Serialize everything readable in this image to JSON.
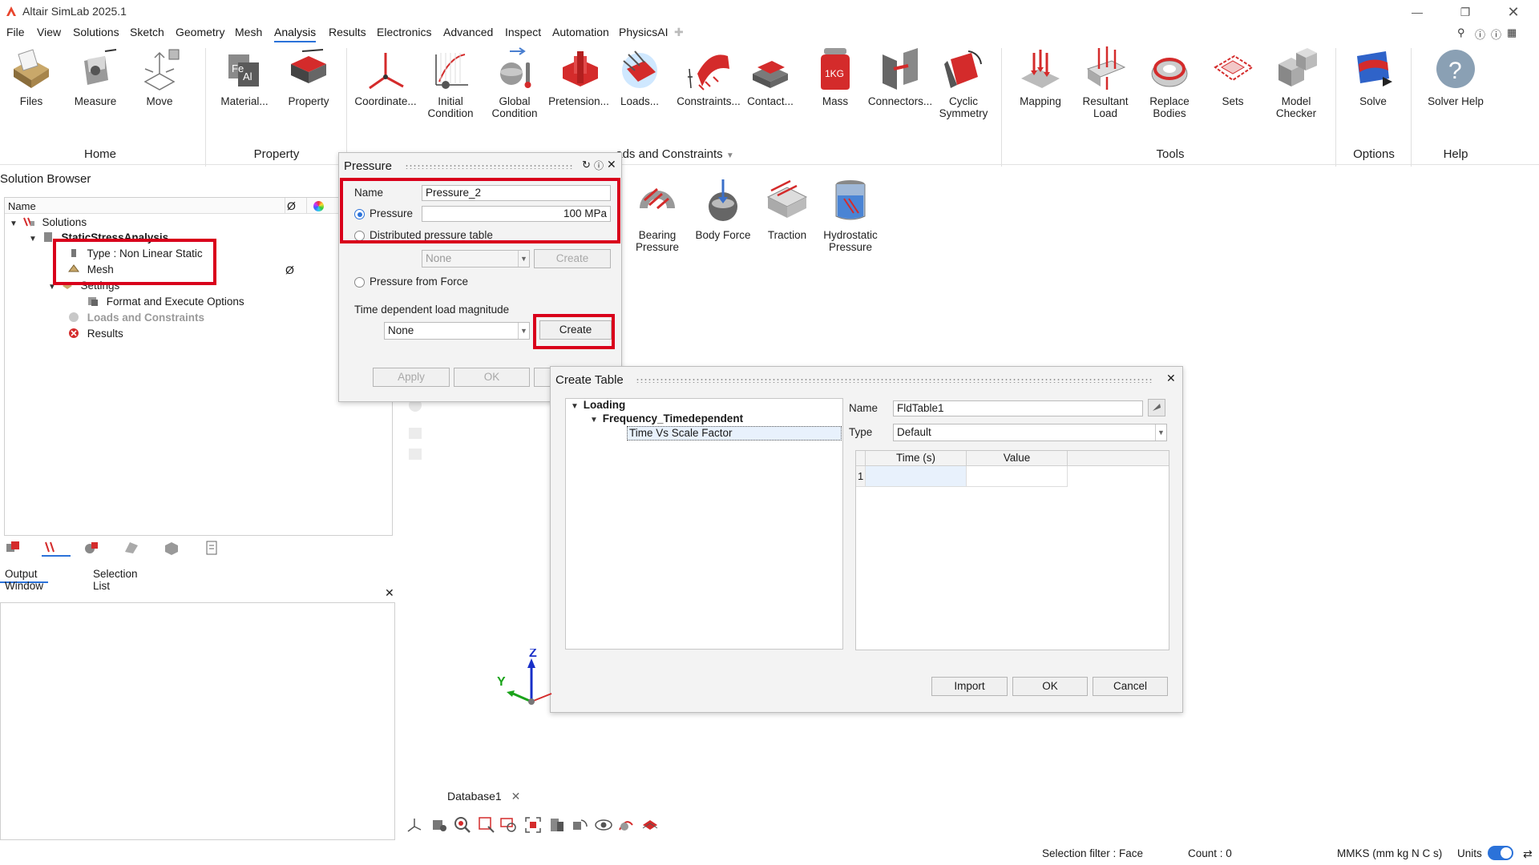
{
  "app": {
    "title": "Altair SimLab 2025.1"
  },
  "menu": {
    "items": [
      "File",
      "View",
      "Solutions",
      "Sketch",
      "Geometry",
      "Mesh",
      "Analysis",
      "Results",
      "Electronics",
      "Advanced",
      "Inspect",
      "Automation",
      "PhysicsAI"
    ],
    "active": "Analysis"
  },
  "ribbon": {
    "buttons": {
      "files": "Files",
      "measure": "Measure",
      "move": "Move",
      "material": "Material...",
      "property": "Property",
      "coordinate": "Coordinate...",
      "initial_condition": "Initial\nCondition",
      "global_condition": "Global\nCondition",
      "pretension": "Pretension...",
      "loads": "Loads...",
      "constraints": "Constraints...",
      "contact": "Contact...",
      "mass": "Mass",
      "connectors": "Connectors...",
      "cyclic_symmetry": "Cyclic\nSymmetry",
      "mapping": "Mapping",
      "resultant_load": "Resultant\nLoad",
      "replace_bodies": "Replace\nBodies",
      "sets": "Sets",
      "model_checker": "Model\nChecker",
      "solve": "Solve",
      "solver_help": "Solver Help"
    },
    "groups": {
      "home": "Home",
      "property": "Property",
      "loads_constraints": "ads and Constraints",
      "tools": "Tools",
      "options": "Options",
      "help": "Help"
    },
    "mass_icon_text": "1KG",
    "sub_buttons": {
      "bearing_pressure": "Bearing\nPressure",
      "body_force": "Body Force",
      "traction": "Traction",
      "hydrostatic_pressure": "Hydrostatic\nPressure"
    }
  },
  "solution_browser": {
    "title": "Solution Browser",
    "columns": {
      "name": "Name",
      "suppress": "Ø"
    },
    "tree": {
      "solutions": "Solutions",
      "analysis": "StaticStressAnalysis",
      "type": "Type : Non Linear Static",
      "mesh": "Mesh",
      "mesh_flag": "Ø",
      "settings": "Settings",
      "format_execute": "Format and Execute Options",
      "loads_constraints": "Loads and Constraints",
      "results": "Results"
    }
  },
  "output": {
    "tabs": [
      "Output Window",
      "Selection List"
    ],
    "active": "Output Window"
  },
  "pressure_dialog": {
    "title": "Pressure",
    "name_label": "Name",
    "name_value": "Pressure_2",
    "pressure_option": "Pressure",
    "pressure_value": "100 MPa",
    "distributed_option": "Distributed pressure table",
    "table_select": "None",
    "table_create": "Create",
    "from_force_option": "Pressure from Force",
    "time_dep_label": "Time dependent load magnitude",
    "time_dep_select": "None",
    "time_dep_create": "Create",
    "apply": "Apply",
    "ok": "OK"
  },
  "create_table_dialog": {
    "title": "Create Table",
    "tree": {
      "loading": "Loading",
      "frequency": "Frequency_Timedependent",
      "time_vs_scale": "Time Vs Scale Factor"
    },
    "name_label": "Name",
    "name_value": "FldTable1",
    "type_label": "Type",
    "type_value": "Default",
    "columns": [
      "Time (s)",
      "Value"
    ],
    "row_number": "1",
    "import": "Import",
    "ok": "OK",
    "cancel": "Cancel"
  },
  "viewport": {
    "axis_z": "Z",
    "axis_y": "Y",
    "database_tab": "Database1"
  },
  "status": {
    "selection_filter": "Selection filter : Face",
    "count": "Count : 0",
    "units_system": "MMKS (mm kg N C s)",
    "units_label": "Units"
  },
  "colors": {
    "accent": "#2b72d9",
    "highlight": "#d9001b",
    "icon_red": "#d42b2b"
  }
}
